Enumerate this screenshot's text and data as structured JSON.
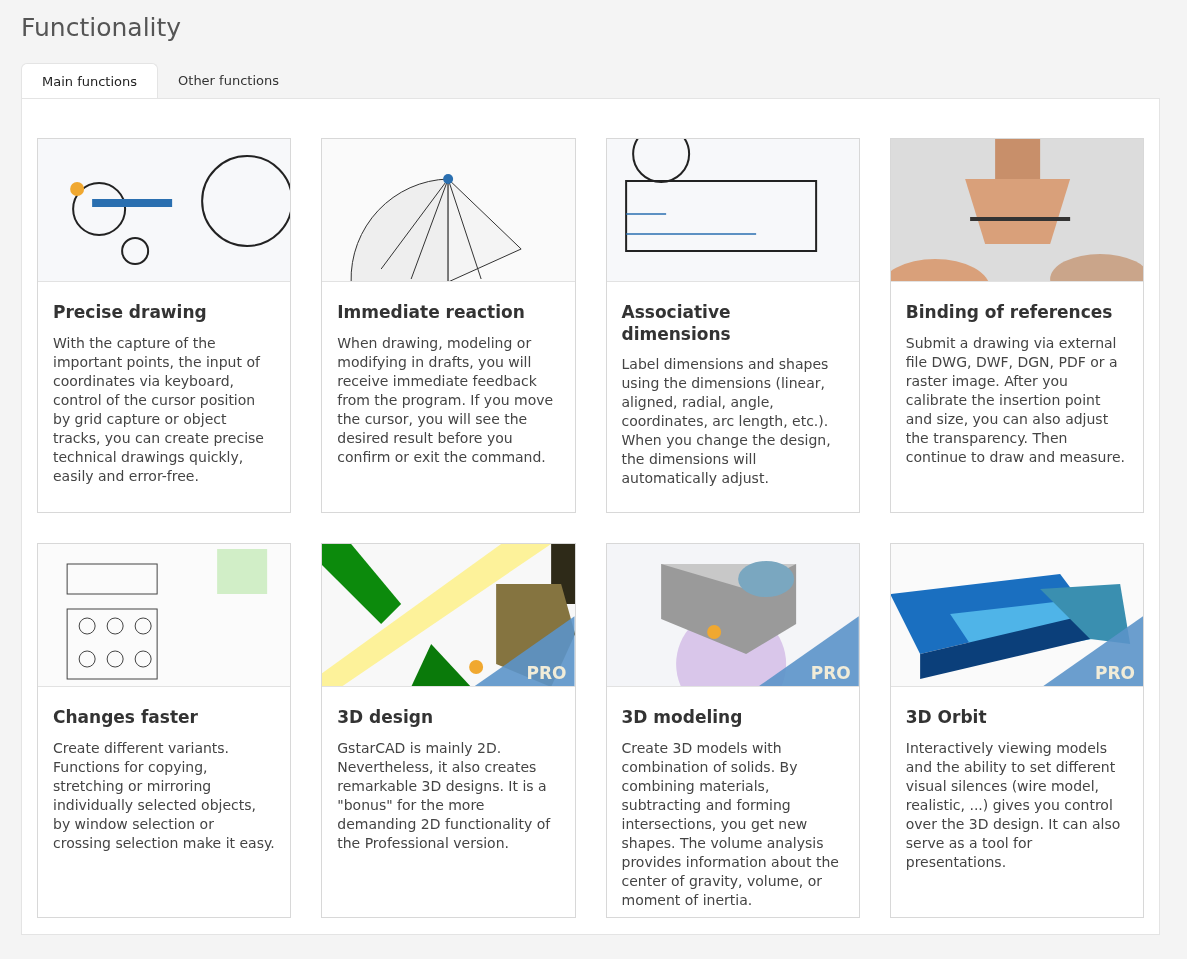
{
  "title": "Functionality",
  "tabs": [
    {
      "label": "Main functions",
      "selected": true
    },
    {
      "label": "Other functions",
      "selected": false
    }
  ],
  "cards": [
    {
      "title": "Precise drawing",
      "text": "With the capture of the important points, the input of coordinates via keyboard, control of the cursor position by grid capture or object tracks, you can create precise technical drawings quickly, easily and error-free."
    },
    {
      "title": "Immediate reaction",
      "text": "When drawing, modeling or modifying in drafts, you will receive immediate feedback from the program. If you move the cursor, you will see the desired result before you confirm or exit the command."
    },
    {
      "title": "Associative dimensions",
      "text": "Label dimensions and shapes using the dimensions (linear, aligned, radial, angle, coordinates, arc length, etc.). When you change the design, the dimensions will automatically adjust."
    },
    {
      "title": "Binding of references",
      "text": "Submit a drawing via external file DWG, DWF, DGN, PDF or a raster image. After you calibrate the insertion point and size, you can also adjust the transparency. Then continue to draw and measure."
    },
    {
      "title": "Changes faster",
      "text": "Create different variants. Functions for copying, stretching or mirroring individually selected objects, by window selection or crossing selection make it easy."
    },
    {
      "title": "3D design",
      "badge": "PRO",
      "text": "GstarCAD is mainly 2D. Nevertheless, it also creates remarkable 3D designs. It is a \"bonus\" for the more demanding 2D functionality of the Professional version."
    },
    {
      "title": "3D modeling",
      "badge": "PRO",
      "text": "Create 3D models with combination of solids. By combining materials, subtracting and forming intersections, you get new shapes. The volume analysis provides information about the center of gravity, volume, or moment of inertia."
    },
    {
      "title": "3D Orbit",
      "badge": "PRO",
      "text": "Interactively viewing models and the ability to set different visual silences (wire model, realistic, ...) gives you control over the 3D design. It can also serve as a tool for presentations."
    }
  ]
}
